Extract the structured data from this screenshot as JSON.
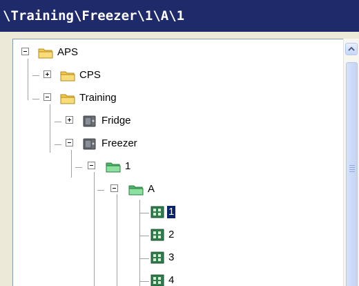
{
  "window": {
    "title": "\\Training\\Freezer\\1\\A\\1"
  },
  "tree": {
    "nodes": [
      {
        "label": "APS",
        "icon": "folder-icon",
        "expanded": true
      },
      {
        "label": "CPS",
        "icon": "folder-icon",
        "expanded": false
      },
      {
        "label": "Training",
        "icon": "folder-icon",
        "expanded": true
      },
      {
        "label": "Fridge",
        "icon": "safe-icon",
        "expanded": false
      },
      {
        "label": "Freezer",
        "icon": "safe-icon",
        "expanded": true
      },
      {
        "label": "1",
        "icon": "green-folder-icon",
        "expanded": true
      },
      {
        "label": "A",
        "icon": "green-folder-icon",
        "expanded": true
      },
      {
        "label": "1",
        "icon": "box-grid-icon",
        "selected": true
      },
      {
        "label": "2",
        "icon": "box-grid-icon"
      },
      {
        "label": "3",
        "icon": "box-grid-icon"
      },
      {
        "label": "4",
        "icon": "box-grid-icon"
      }
    ]
  },
  "colors": {
    "titlebar": "#1f2a6b",
    "selection": "#0a246a",
    "folder": "#f4c94a",
    "green_folder": "#6ccf86",
    "box": "#2f7d4a"
  }
}
